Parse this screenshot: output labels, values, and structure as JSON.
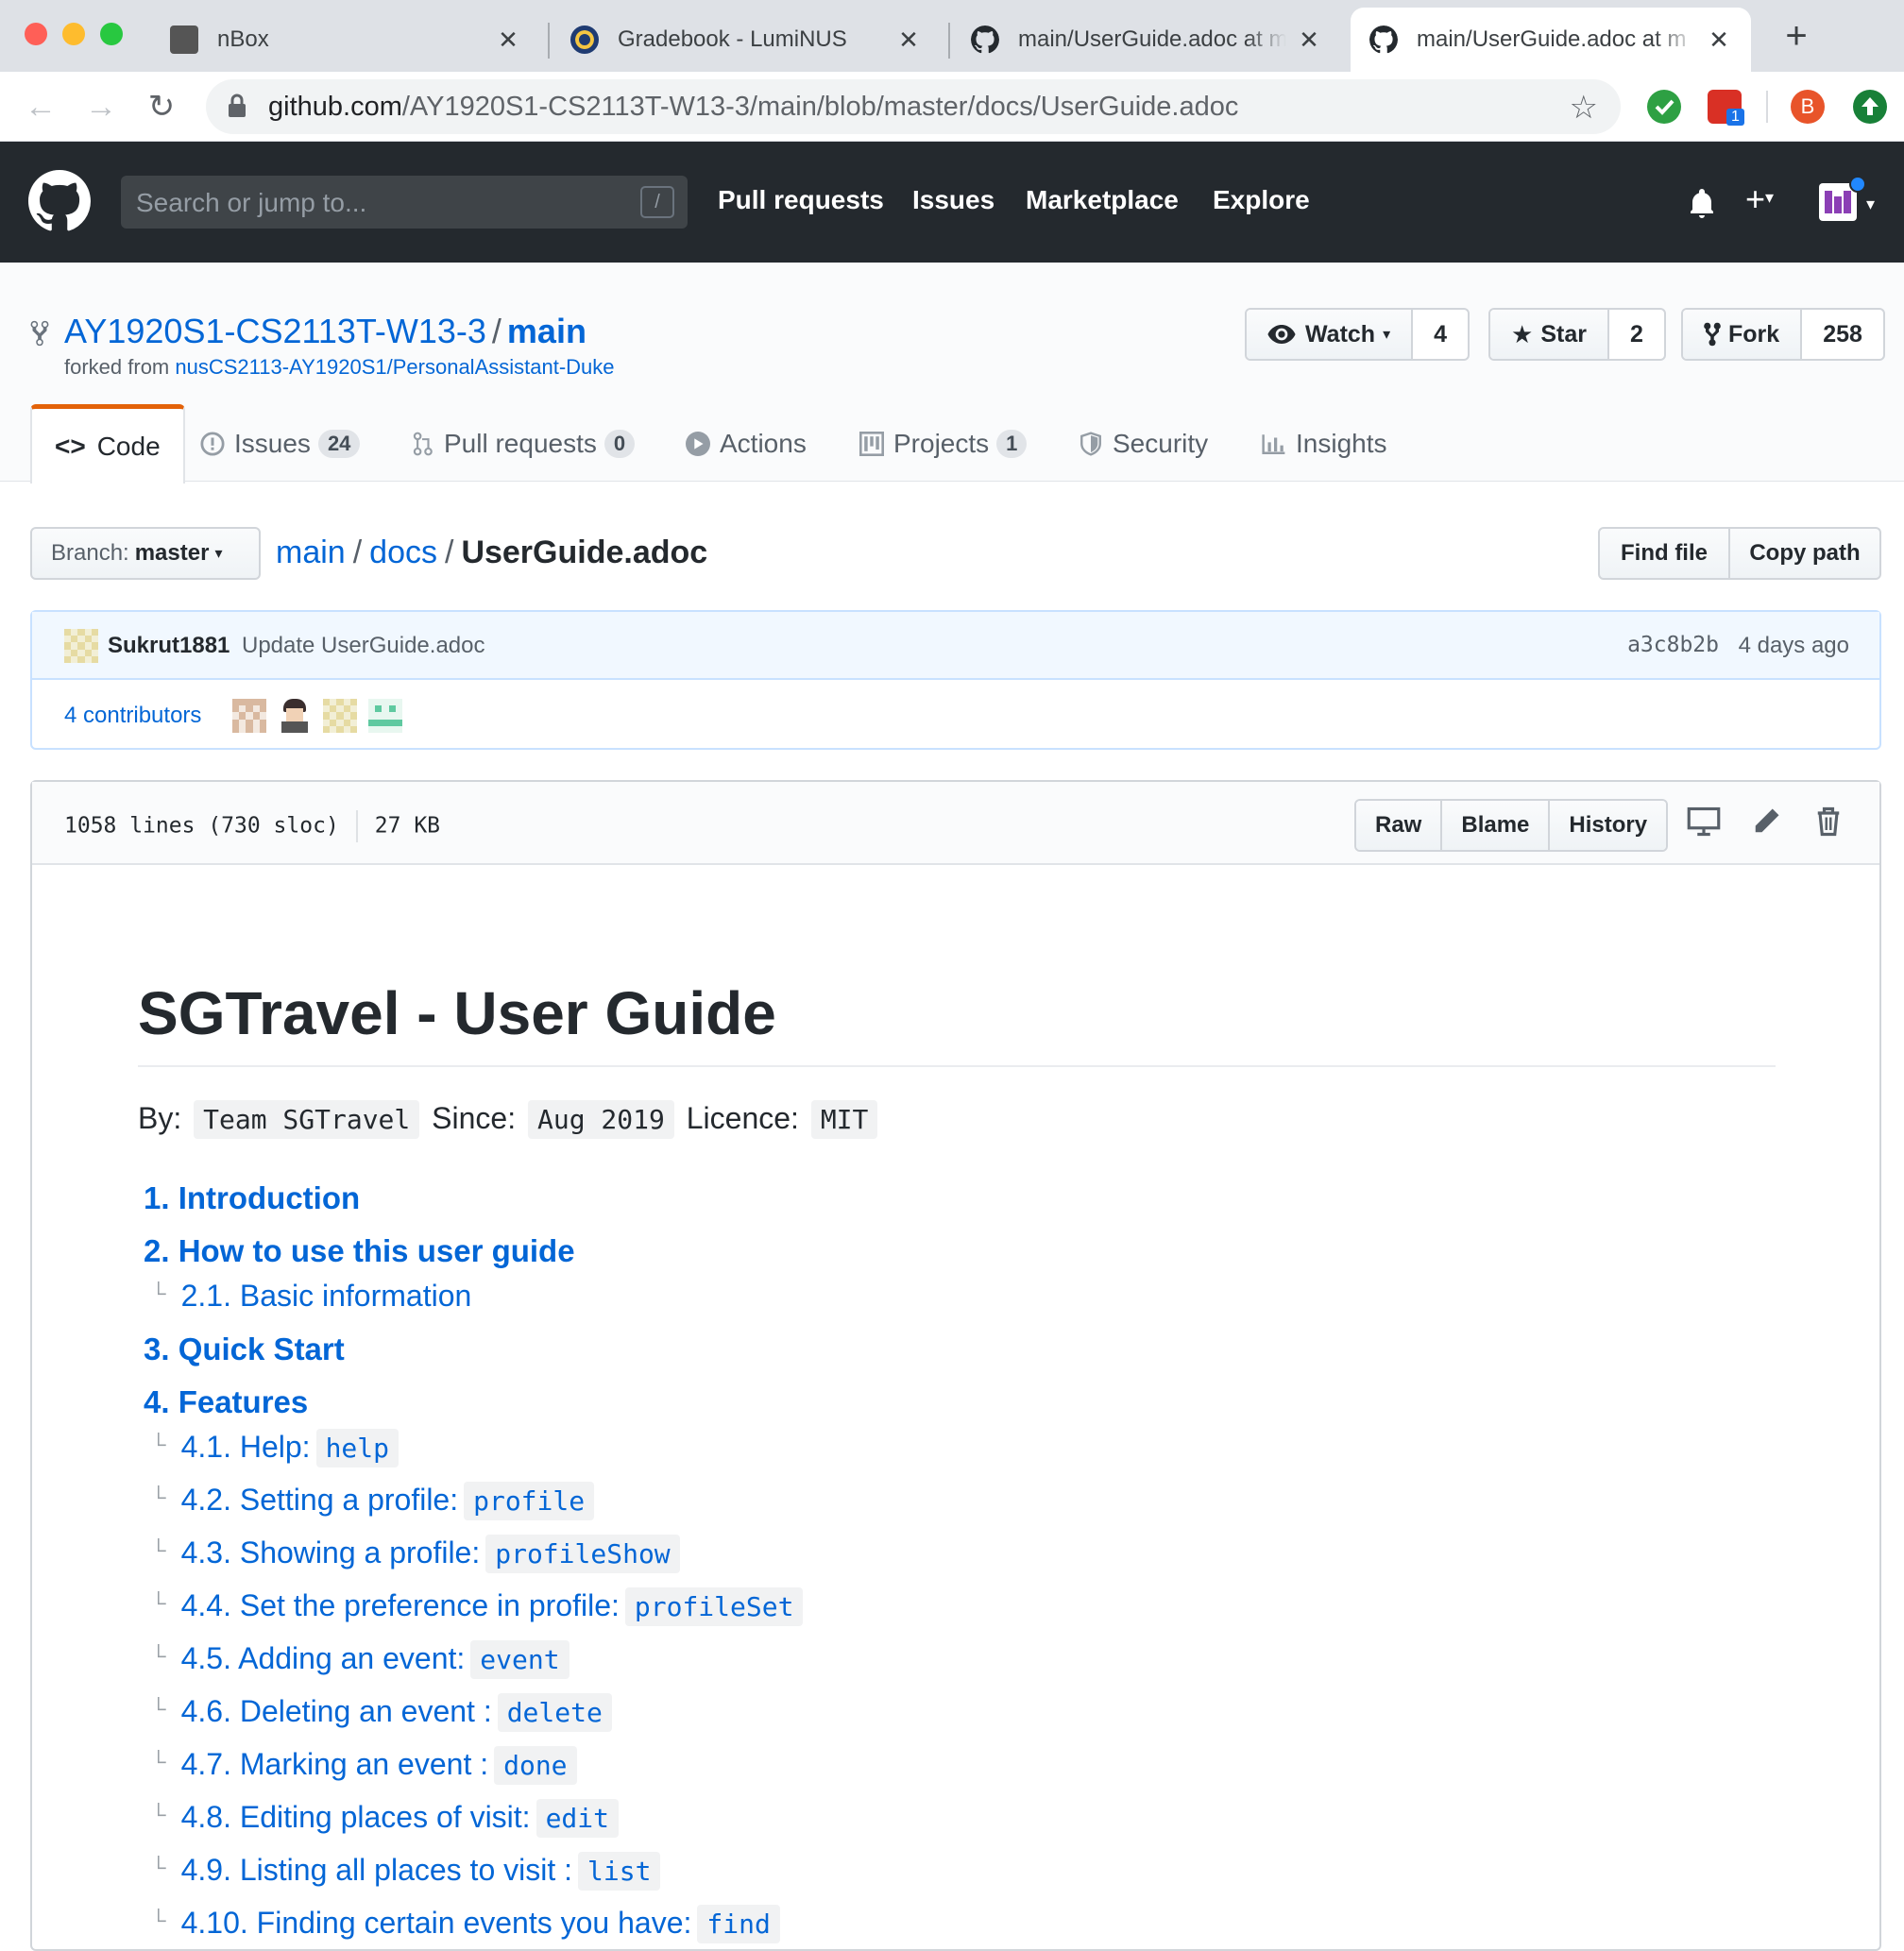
{
  "browser": {
    "tabs": [
      {
        "title": "nBox",
        "active": false,
        "icon": "nbox-icon"
      },
      {
        "title": "Gradebook - LumiNUS",
        "active": false,
        "icon": "luminus-icon"
      },
      {
        "title": "main/UserGuide.adoc at m",
        "active": false,
        "icon": "github-icon"
      },
      {
        "title": "main/UserGuide.adoc at m",
        "active": true,
        "icon": "github-icon"
      }
    ],
    "url_host": "github.com",
    "url_path": "/AY1920S1-CS2113T-W13-3/main/blob/master/docs/UserGuide.adoc",
    "ext_badge": "1",
    "profile_initial": "B"
  },
  "header": {
    "search_placeholder": "Search or jump to...",
    "search_shortcut": "/",
    "nav": [
      "Pull requests",
      "Issues",
      "Marketplace",
      "Explore"
    ]
  },
  "repo": {
    "owner": "AY1920S1-CS2113T-W13-3",
    "name": "main",
    "forked_prefix": "forked from",
    "forked_from": "nusCS2113-AY1920S1/PersonalAssistant-Duke",
    "watch_label": "Watch",
    "watch_count": "4",
    "star_label": "Star",
    "star_count": "2",
    "fork_label": "Fork",
    "fork_count": "258",
    "tabs": [
      {
        "label": "Code",
        "count": ""
      },
      {
        "label": "Issues",
        "count": "24"
      },
      {
        "label": "Pull requests",
        "count": "0"
      },
      {
        "label": "Actions",
        "count": ""
      },
      {
        "label": "Projects",
        "count": "1"
      },
      {
        "label": "Security",
        "count": ""
      },
      {
        "label": "Insights",
        "count": ""
      }
    ]
  },
  "filenav": {
    "branch_label": "Branch:",
    "branch": "master",
    "crumbs": [
      "main",
      "docs",
      "UserGuide.adoc"
    ],
    "find_file": "Find file",
    "copy_path": "Copy path"
  },
  "commit": {
    "author": "Sukrut1881",
    "message": "Update UserGuide.adoc",
    "sha": "a3c8b2b",
    "time": "4 days ago",
    "contributors": "4 contributors"
  },
  "file": {
    "lines": "1058 lines (730 sloc)",
    "size": "27 KB",
    "raw": "Raw",
    "blame": "Blame",
    "history": "History"
  },
  "doc": {
    "title": "SGTravel - User Guide",
    "by_label": "By:",
    "by": "Team SGTravel",
    "since_label": "Since:",
    "since": "Aug 2019",
    "licence_label": "Licence:",
    "licence": "MIT",
    "toc": [
      {
        "text": "1. Introduction",
        "level": 1,
        "code": ""
      },
      {
        "text": "2. How to use this user guide",
        "level": 1,
        "code": ""
      },
      {
        "text": "2.1. Basic information",
        "level": 2,
        "code": ""
      },
      {
        "text": "3. Quick Start",
        "level": 1,
        "code": ""
      },
      {
        "text": "4. Features",
        "level": 1,
        "code": ""
      },
      {
        "text": "4.1. Help:",
        "level": 2,
        "code": "help"
      },
      {
        "text": "4.2. Setting a profile:",
        "level": 2,
        "code": "profile"
      },
      {
        "text": "4.3. Showing a profile:",
        "level": 2,
        "code": "profileShow"
      },
      {
        "text": "4.4. Set the preference in profile:",
        "level": 2,
        "code": "profileSet"
      },
      {
        "text": "4.5. Adding an event:",
        "level": 2,
        "code": "event"
      },
      {
        "text": "4.6. Deleting an event :",
        "level": 2,
        "code": "delete"
      },
      {
        "text": "4.7. Marking an event :",
        "level": 2,
        "code": "done"
      },
      {
        "text": "4.8. Editing places of visit:",
        "level": 2,
        "code": "edit"
      },
      {
        "text": "4.9. Listing all places to visit :",
        "level": 2,
        "code": "list"
      },
      {
        "text": "4.10. Finding certain events you have:",
        "level": 2,
        "code": "find"
      }
    ]
  }
}
